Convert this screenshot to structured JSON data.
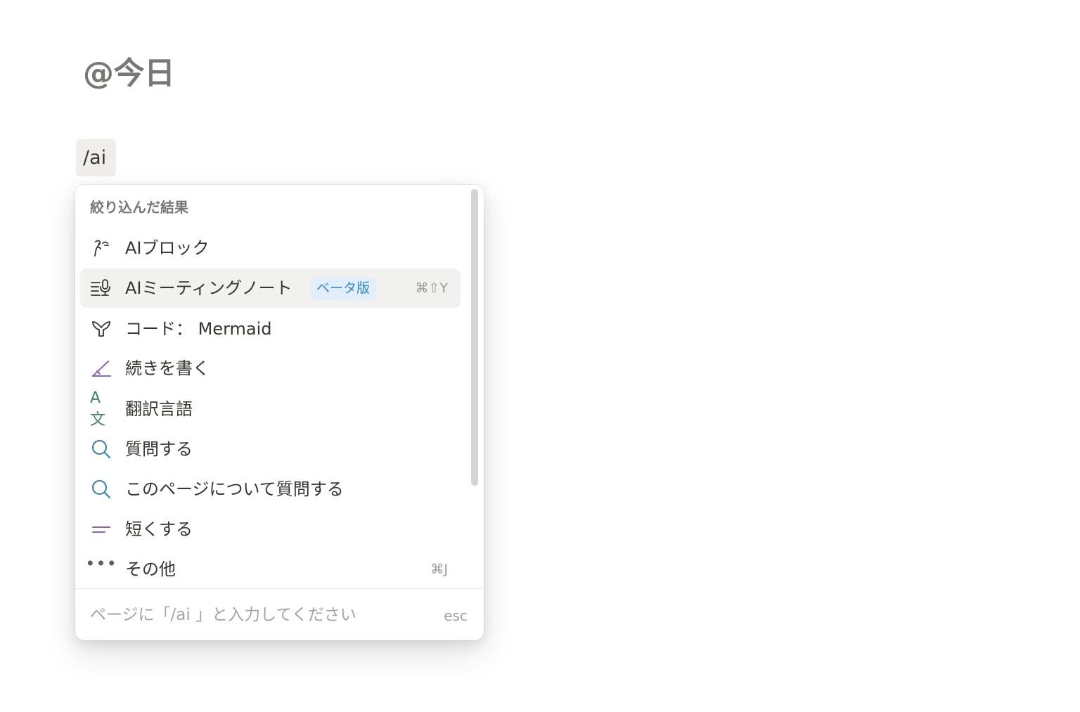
{
  "page": {
    "title": "@今日",
    "slash_input": "/ai"
  },
  "menu": {
    "section_header": "絞り込んだ結果",
    "items": [
      {
        "label": "AIブロック",
        "icon": "ai-face-icon",
        "shortcut": "",
        "badge": ""
      },
      {
        "label": "AIミーティングノート",
        "icon": "meeting-notes-mic-icon",
        "shortcut": "⌘⇧Y",
        "badge": "ベータ版",
        "active": true
      },
      {
        "label": "コード： Mermaid",
        "icon": "mermaid-tail-icon",
        "shortcut": "",
        "badge": ""
      },
      {
        "label": "続きを書く",
        "icon": "pen-angle-icon",
        "shortcut": "",
        "badge": ""
      },
      {
        "label": "翻訳言語",
        "icon": "translate-icon",
        "icon_text": "A文",
        "shortcut": "",
        "badge": ""
      },
      {
        "label": "質問する",
        "icon": "search-icon",
        "shortcut": "",
        "badge": ""
      },
      {
        "label": "このページについて質問する",
        "icon": "search-icon",
        "shortcut": "",
        "badge": ""
      },
      {
        "label": "短くする",
        "icon": "shorten-lines-icon",
        "shortcut": "",
        "badge": ""
      },
      {
        "label": "その他",
        "icon": "more-dots-icon",
        "icon_text": "•••",
        "shortcut": "⌘J",
        "badge": ""
      }
    ],
    "footer": {
      "hint": "ページに「/ai 」と入力してください",
      "esc": "esc"
    }
  },
  "colors": {
    "accent_blue": "#2f87d3",
    "badge_bg": "#e3eefb",
    "translate_green": "#448361",
    "search_blue": "#337ea9",
    "ai_purple": "#9065b0",
    "text_primary": "#37352f",
    "text_muted": "#787774",
    "active_row_bg": "#f1f1ef"
  }
}
